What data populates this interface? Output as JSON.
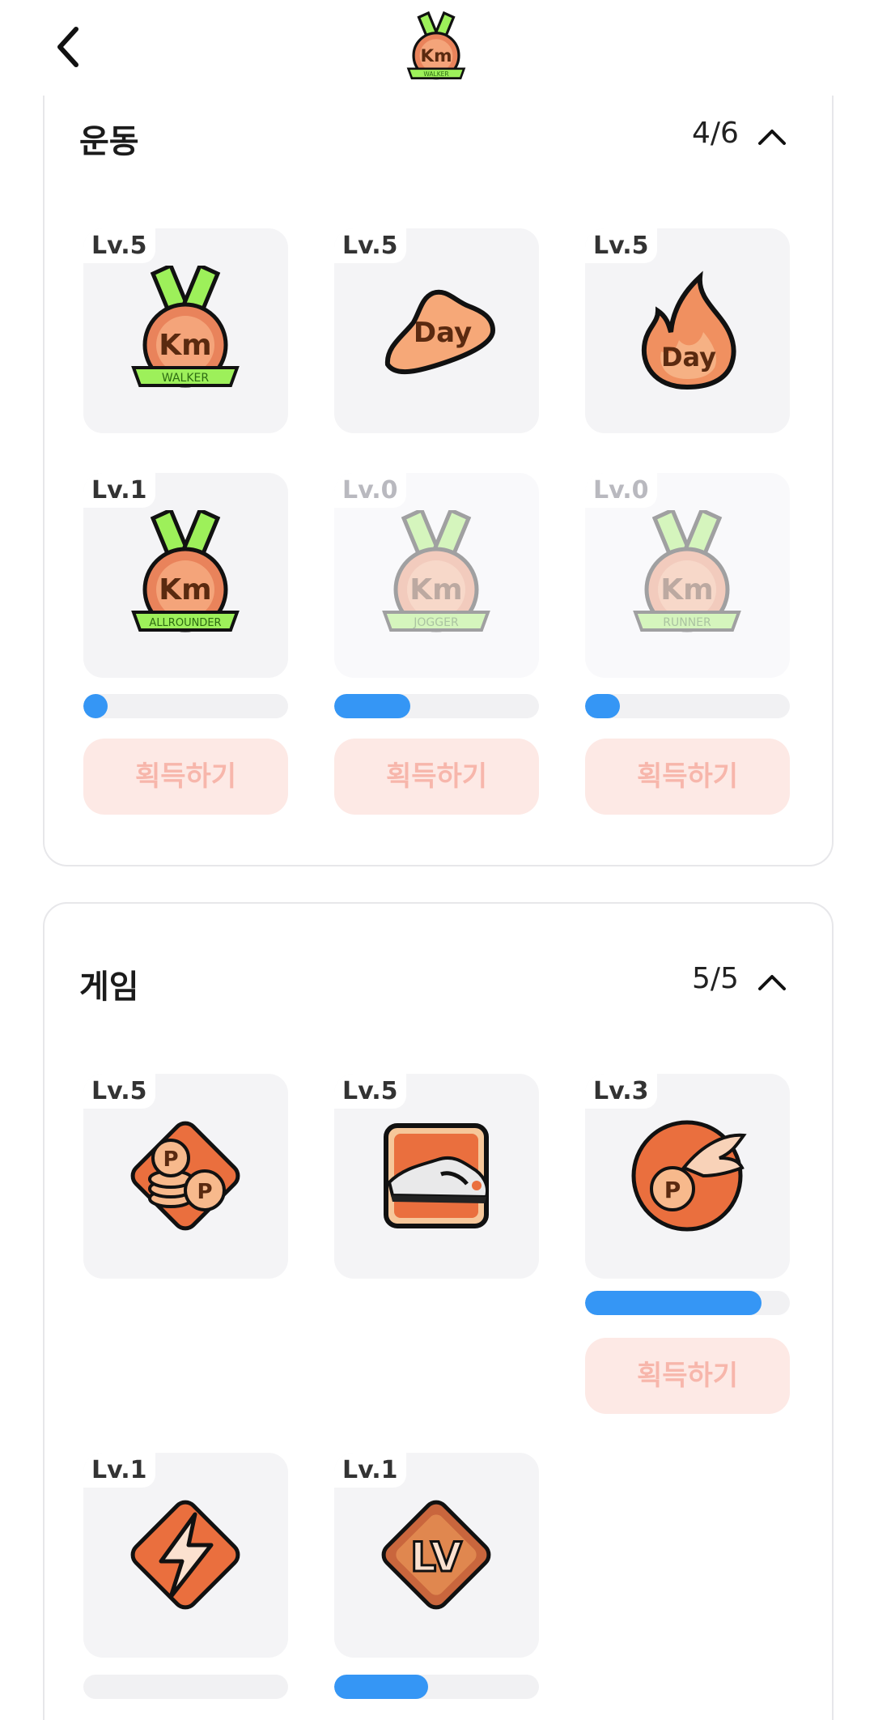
{
  "header": {
    "back_icon": "back-arrow-icon",
    "badge_icon": "km-walker-medal-icon",
    "badge_caption": "WALKER"
  },
  "colors": {
    "accent_blue": "#3596f5",
    "button_bg": "#fde9e5",
    "button_text": "#f7b6ab",
    "tile_bg": "#f4f4f6"
  },
  "sections": [
    {
      "title": "운동",
      "count": "4/6",
      "badges": [
        {
          "level": "Lv.5",
          "icon": "km-walker-medal-icon",
          "main": "Km",
          "ribbon": "WALKER"
        },
        {
          "level": "Lv.5",
          "icon": "day-sneaker-icon",
          "main": "Day"
        },
        {
          "level": "Lv.5",
          "icon": "day-flame-icon",
          "main": "Day"
        },
        {
          "level": "Lv.1",
          "icon": "km-allrounder-medal-icon",
          "main": "Km",
          "ribbon": "ALLROUNDER",
          "progress": 0.06,
          "button": "획득하기"
        },
        {
          "level": "Lv.0",
          "icon": "km-jogger-medal-icon",
          "main": "Km",
          "ribbon": "JOGGER",
          "progress": 0.37,
          "button": "획득하기"
        },
        {
          "level": "Lv.0",
          "icon": "km-runner-medal-icon",
          "main": "Km",
          "ribbon": "RUNNER",
          "progress": 0.17,
          "button": "획득하기"
        }
      ]
    },
    {
      "title": "게임",
      "count": "5/5",
      "badges": [
        {
          "level": "Lv.5",
          "icon": "point-coins-icon",
          "main": "P"
        },
        {
          "level": "Lv.5",
          "icon": "sneaker-card-icon"
        },
        {
          "level": "Lv.3",
          "icon": "winged-point-icon",
          "main": "P",
          "progress": 0.86,
          "button": "획득하기"
        },
        {
          "level": "Lv.1",
          "icon": "lightning-icon",
          "progress": 0.0
        },
        {
          "level": "Lv.1",
          "icon": "lv-diamond-icon",
          "main": "LV",
          "progress": 0.46
        }
      ]
    }
  ]
}
